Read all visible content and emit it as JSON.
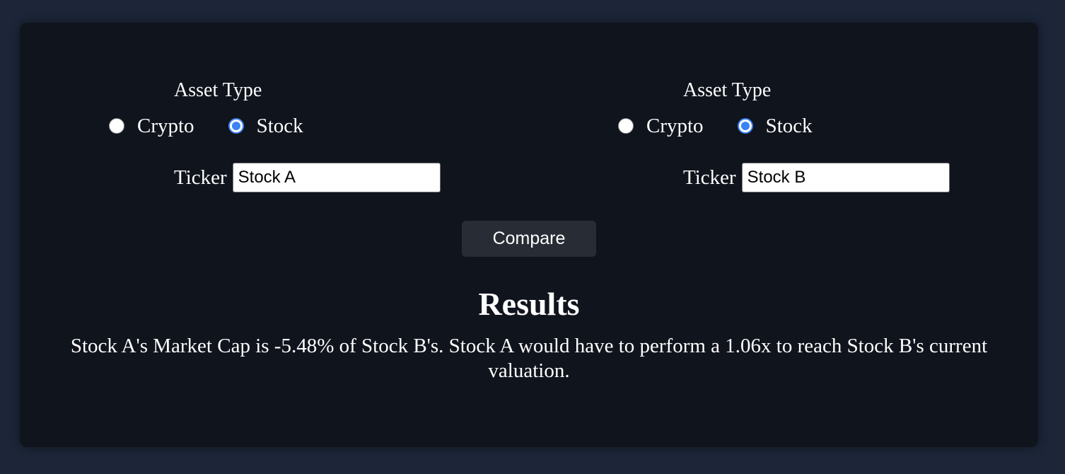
{
  "left_asset": {
    "asset_type_label": "Asset Type",
    "options": [
      {
        "label": "Crypto",
        "checked": false
      },
      {
        "label": "Stock",
        "checked": true
      }
    ],
    "ticker_label": "Ticker",
    "ticker_value": "Stock A"
  },
  "right_asset": {
    "asset_type_label": "Asset Type",
    "options": [
      {
        "label": "Crypto",
        "checked": false
      },
      {
        "label": "Stock",
        "checked": true
      }
    ],
    "ticker_label": "Ticker",
    "ticker_value": "Stock B"
  },
  "compare_button_label": "Compare",
  "results": {
    "heading": "Results",
    "text": "Stock A's Market Cap is -5.48% of Stock B's. Stock A would have to perform a 1.06x to reach Stock B's current valuation."
  },
  "colors": {
    "page_background": "#1c2638",
    "card_background": "#10141d",
    "button_background": "#282c35",
    "radio_accent": "#3b82f6"
  }
}
